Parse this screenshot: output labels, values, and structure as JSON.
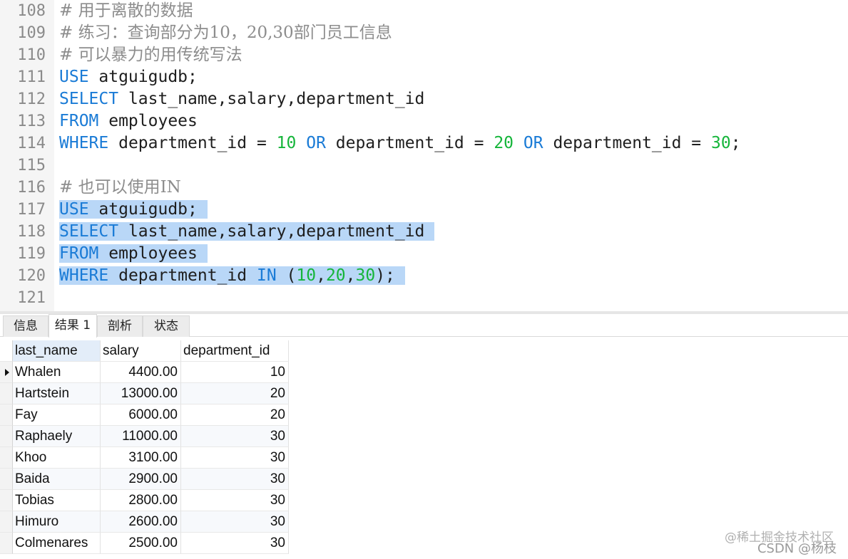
{
  "editor": {
    "lines": [
      {
        "num": "108",
        "tokens": [
          {
            "t": "cm",
            "v": "# 用于离散的数据"
          }
        ]
      },
      {
        "num": "109",
        "tokens": [
          {
            "t": "cm",
            "v": "# 练习：查询部分为10，20,30部门员工信息"
          }
        ]
      },
      {
        "num": "110",
        "tokens": [
          {
            "t": "cm",
            "v": "# 可以暴力的用传统写法"
          }
        ]
      },
      {
        "num": "111",
        "tokens": [
          {
            "t": "kw",
            "v": "USE"
          },
          {
            "t": "pl",
            "v": " atguigudb;"
          }
        ]
      },
      {
        "num": "112",
        "tokens": [
          {
            "t": "kw",
            "v": "SELECT"
          },
          {
            "t": "pl",
            "v": " last_name,salary,department_id"
          }
        ]
      },
      {
        "num": "113",
        "tokens": [
          {
            "t": "kw",
            "v": "FROM"
          },
          {
            "t": "pl",
            "v": " employees"
          }
        ]
      },
      {
        "num": "114",
        "tokens": [
          {
            "t": "kw",
            "v": "WHERE"
          },
          {
            "t": "pl",
            "v": " department_id = "
          },
          {
            "t": "num",
            "v": "10"
          },
          {
            "t": "pl",
            "v": " "
          },
          {
            "t": "kw",
            "v": "OR"
          },
          {
            "t": "pl",
            "v": " department_id = "
          },
          {
            "t": "num",
            "v": "20"
          },
          {
            "t": "pl",
            "v": " "
          },
          {
            "t": "kw",
            "v": "OR"
          },
          {
            "t": "pl",
            "v": " department_id = "
          },
          {
            "t": "num",
            "v": "30"
          },
          {
            "t": "pl",
            "v": ";"
          }
        ]
      },
      {
        "num": "115",
        "tokens": []
      },
      {
        "num": "116",
        "tokens": [
          {
            "t": "cm",
            "v": "# 也可以使用IN"
          }
        ]
      },
      {
        "num": "117",
        "selected": true,
        "tokens": [
          {
            "t": "kw",
            "v": "USE"
          },
          {
            "t": "pl",
            "v": " atguigudb;"
          }
        ]
      },
      {
        "num": "118",
        "selected": true,
        "tokens": [
          {
            "t": "kw",
            "v": "SELECT"
          },
          {
            "t": "pl",
            "v": " last_name,salary,department_id"
          }
        ]
      },
      {
        "num": "119",
        "selected": true,
        "tokens": [
          {
            "t": "kw",
            "v": "FROM"
          },
          {
            "t": "pl",
            "v": " employees"
          }
        ]
      },
      {
        "num": "120",
        "selected": true,
        "tokens": [
          {
            "t": "kw",
            "v": "WHERE"
          },
          {
            "t": "pl",
            "v": " department_id "
          },
          {
            "t": "kw",
            "v": "IN"
          },
          {
            "t": "pl",
            "v": " ("
          },
          {
            "t": "num",
            "v": "10"
          },
          {
            "t": "pl",
            "v": ","
          },
          {
            "t": "num",
            "v": "20"
          },
          {
            "t": "pl",
            "v": ","
          },
          {
            "t": "num",
            "v": "30"
          },
          {
            "t": "pl",
            "v": ");"
          }
        ]
      },
      {
        "num": "121",
        "tokens": []
      }
    ]
  },
  "tabs": [
    {
      "label": "信息",
      "active": false
    },
    {
      "label": "结果 1",
      "active": true
    },
    {
      "label": "剖析",
      "active": false
    },
    {
      "label": "状态",
      "active": false
    }
  ],
  "grid": {
    "columns": [
      "last_name",
      "salary",
      "department_id"
    ],
    "rows": [
      [
        "Whalen",
        "4400.00",
        "10"
      ],
      [
        "Hartstein",
        "13000.00",
        "20"
      ],
      [
        "Fay",
        "6000.00",
        "20"
      ],
      [
        "Raphaely",
        "11000.00",
        "30"
      ],
      [
        "Khoo",
        "3100.00",
        "30"
      ],
      [
        "Baida",
        "2900.00",
        "30"
      ],
      [
        "Tobias",
        "2800.00",
        "30"
      ],
      [
        "Himuro",
        "2600.00",
        "30"
      ],
      [
        "Colmenares",
        "2500.00",
        "30"
      ]
    ],
    "current_row": 0
  },
  "watermark": {
    "line1": "@稀土掘金技术社区",
    "line2": "CSDN @杨枝"
  }
}
